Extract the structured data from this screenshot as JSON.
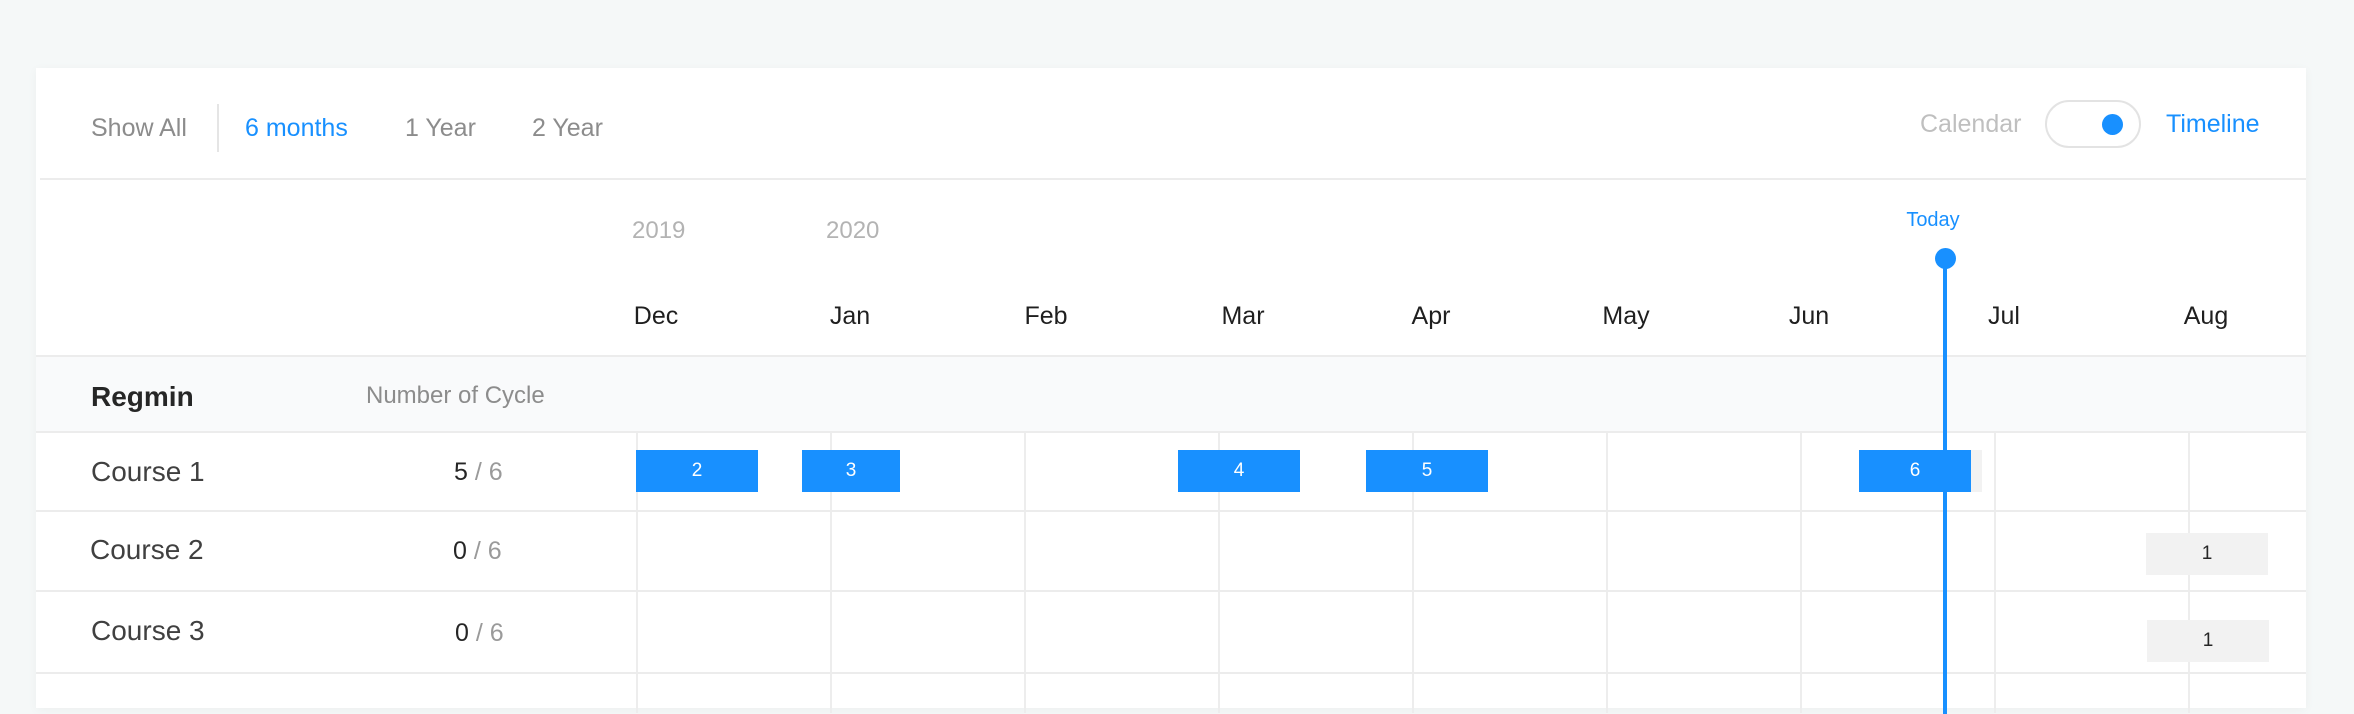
{
  "toolbar": {
    "ranges": [
      "Show All",
      "6 months",
      "1 Year",
      "2 Year"
    ],
    "active_range": "6 months",
    "view_left_label": "Calendar",
    "view_right_label": "Timeline",
    "view_selected": "Timeline"
  },
  "timeline": {
    "years": [
      "2019",
      "2020"
    ],
    "months": [
      "Dec",
      "Jan",
      "Feb",
      "Mar",
      "Apr",
      "May",
      "Jun",
      "Jul",
      "Aug"
    ],
    "today_label": "Today"
  },
  "table": {
    "col_regmin": "Regmin",
    "col_cycles": "Number of Cycle",
    "rows": [
      {
        "name": "Course 1",
        "done": "5",
        "total": "/ 6",
        "bars": [
          {
            "label": "2",
            "state": "done"
          },
          {
            "label": "3",
            "state": "done"
          },
          {
            "label": "4",
            "state": "done"
          },
          {
            "label": "5",
            "state": "done"
          },
          {
            "label": "6",
            "state": "done"
          }
        ]
      },
      {
        "name": "Course 2",
        "done": "0",
        "total": "/ 6",
        "bars": [
          {
            "label": "1",
            "state": "pending"
          }
        ]
      },
      {
        "name": "Course 3",
        "done": "0",
        "total": "/ 6",
        "bars": [
          {
            "label": "1",
            "state": "pending"
          }
        ]
      }
    ]
  },
  "colors": {
    "accent": "#1890ff",
    "pending_bar": "#f2f2f2",
    "grid": "#ededed"
  }
}
